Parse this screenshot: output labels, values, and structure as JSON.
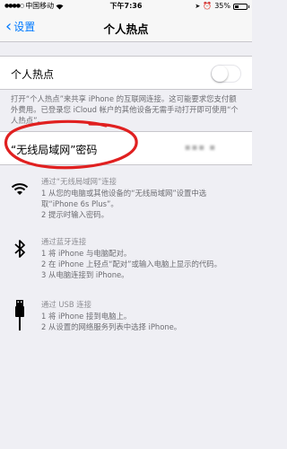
{
  "status": {
    "carrier": "中国移动",
    "time": "下午7:36",
    "battery": "35%",
    "battery_level": 0.35
  },
  "nav": {
    "back_label": "设置",
    "title": "个人热点"
  },
  "hotspot": {
    "label": "个人热点",
    "toggle_on": false,
    "footer": "打开“个人热点”来共享 iPhone 的互联网连接。这可能要求您支付额外费用。已登录您 iCloud 帐户的其他设备无需手动打开即可使用“个人热点”。"
  },
  "wifi_password": {
    "label": "“无线局域网”密码",
    "value": "▪▪▪ ▪"
  },
  "methods": [
    {
      "icon": "wifi-icon",
      "heading": "通过“无线局域网”连接",
      "lines": [
        "1 从您的电脑或其他设备的“无线局域网”设置中选取“iPhone 6s Plus”。",
        "2 提示时输入密码。"
      ]
    },
    {
      "icon": "bluetooth-icon",
      "heading": "通过蓝牙连接",
      "lines": [
        "1 将 iPhone 与电脑配对。",
        "2 在 iPhone 上轻点“配对”或输入电脑上显示的代码。",
        "3 从电脑连接到 iPhone。"
      ]
    },
    {
      "icon": "usb-icon",
      "heading": "通过 USB 连接",
      "lines": [
        "1 将 iPhone 接到电脑上。",
        "2 从设置的网络服务列表中选择 iPhone。"
      ]
    }
  ],
  "colors": {
    "accent": "#007aff",
    "annotation": "#e02020"
  }
}
